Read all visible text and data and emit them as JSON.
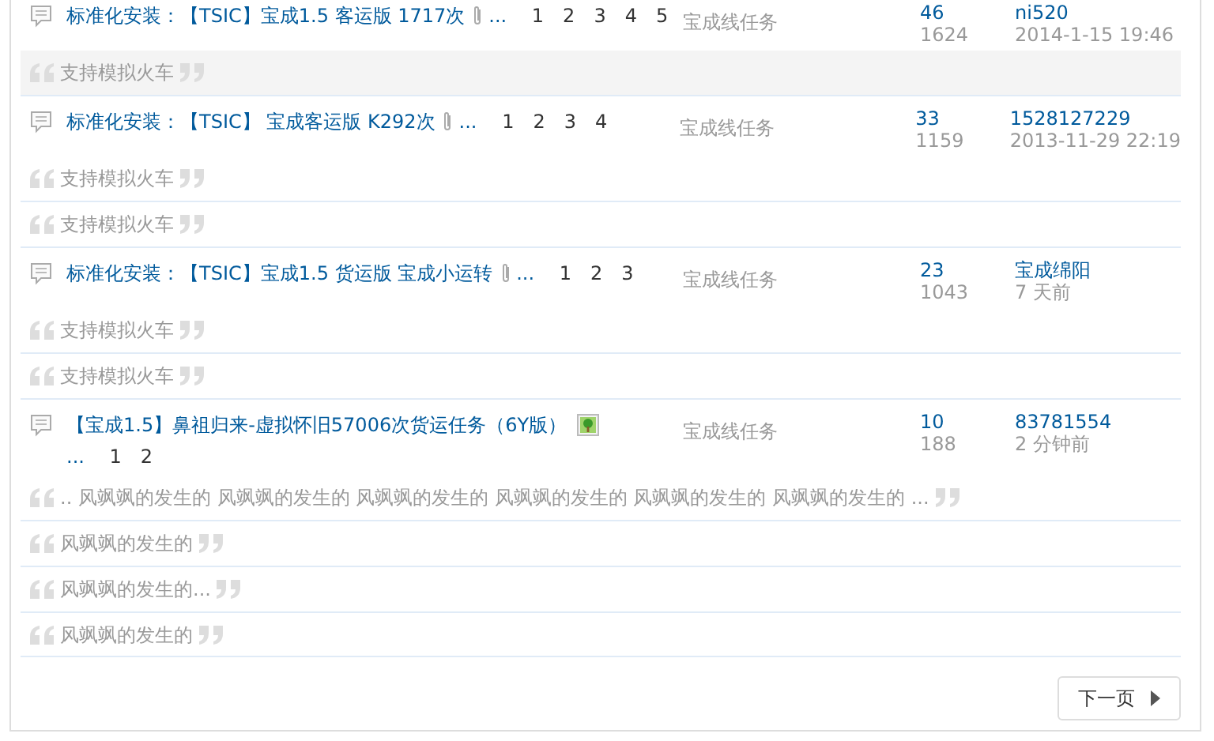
{
  "threads": [
    {
      "title": "标准化安装：【TSIC】宝成1.5 客运版 1717次",
      "kind": "clip",
      "more": "...",
      "pages": [
        "1",
        "2",
        "3",
        "4",
        "5"
      ],
      "forum": "宝成线任务",
      "replies": "46",
      "views": "1624",
      "last_author": "ni520",
      "last_time": "2014-1-15 19:46",
      "quotes": [
        {
          "text": "支持模拟火车",
          "highlighted": true
        }
      ]
    },
    {
      "title": "标准化安装：【TSIC】 宝成客运版 K292次",
      "kind": "clip",
      "more": "...",
      "pages": [
        "1",
        "2",
        "3",
        "4"
      ],
      "forum": "宝成线任务",
      "replies": "33",
      "views": "1159",
      "last_author": "1528127229",
      "last_time": "2013-11-29 22:19",
      "quotes": [
        {
          "text": "支持模拟火车",
          "highlighted": false
        },
        {
          "text": "支持模拟火车",
          "highlighted": false
        }
      ]
    },
    {
      "title": "标准化安装：【TSIC】宝成1.5 货运版 宝成小运转",
      "kind": "clip",
      "more": "...",
      "pages": [
        "1",
        "2",
        "3"
      ],
      "forum": "宝成线任务",
      "replies": "23",
      "views": "1043",
      "last_author": "宝成绵阳",
      "last_time": "7 天前",
      "quotes": [
        {
          "text": "支持模拟火车",
          "highlighted": false
        },
        {
          "text": "支持模拟火车",
          "highlighted": false
        }
      ]
    },
    {
      "title": "【宝成1.5】鼻祖归来-虚拟怀旧57006次货运任务（6Y版）",
      "kind": "image",
      "more": "...",
      "pages": [
        "1",
        "2"
      ],
      "forum": "宝成线任务",
      "replies": "10",
      "views": "188",
      "last_author": "83781554",
      "last_time": "2 分钟前",
      "quotes": [
        {
          "text": ".. 风飒飒的发生的 风飒飒的发生的 风飒飒的发生的 风飒飒的发生的 风飒飒的发生的 风飒飒的发生的 ...",
          "highlighted": false
        },
        {
          "text": "风飒飒的发生的",
          "highlighted": false
        },
        {
          "text": "风飒飒的发生的...",
          "highlighted": false
        },
        {
          "text": "风飒飒的发生的",
          "highlighted": false
        }
      ]
    }
  ],
  "next_page": "下一页"
}
